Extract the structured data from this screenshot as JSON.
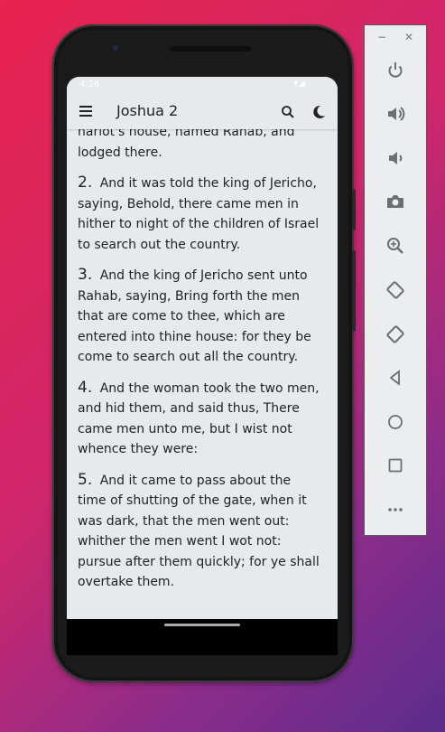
{
  "status_bar": {
    "time": "4:26",
    "icons": "▾◢"
  },
  "app_bar": {
    "title": "Joshua 2"
  },
  "partial_verse": "harlot's house, named Rahab, and lodged there.",
  "verses": [
    {
      "num": "2.",
      "text": "And it was told the king of Jericho, saying, Behold, there came men in hither to night of the children of Israel to search out the country."
    },
    {
      "num": "3.",
      "text": "And the king of Jericho sent unto Rahab, saying, Bring forth the men that are come to thee, which are entered into thine house: for they be come to search out all the country."
    },
    {
      "num": "4.",
      "text": "And the woman took the two men, and hid them, and said thus, There came men unto me, but I wist not whence they were:"
    },
    {
      "num": "5.",
      "text": "And it came to pass about the time of shutting of the gate, when it was dark, that the men went out: whither the men went I wot not: pursue after them quickly; for ye shall overtake them."
    }
  ],
  "emulator": {
    "minimize": "−",
    "close": "✕",
    "buttons": [
      "power-icon",
      "volume-up-icon",
      "volume-down-icon",
      "camera-icon",
      "zoom-icon",
      "rotate-left-icon",
      "rotate-right-icon",
      "back-icon",
      "home-icon",
      "overview-icon",
      "more-icon"
    ]
  }
}
